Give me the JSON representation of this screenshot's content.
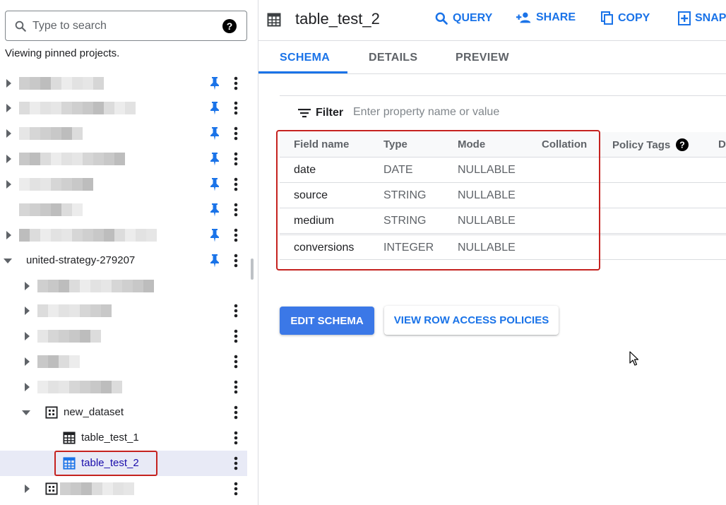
{
  "explorer": {
    "search_placeholder": "Type to search",
    "pinned_message": "Viewing pinned projects.",
    "project_name": "united-strategy-279207",
    "dataset_name": "new_dataset",
    "tables": [
      "table_test_1",
      "table_test_2"
    ],
    "selected_table": "table_test_2"
  },
  "table_header": {
    "title": "table_test_2",
    "actions": [
      "QUERY",
      "SHARE",
      "COPY",
      "SNAP"
    ]
  },
  "tabs": [
    "SCHEMA",
    "DETAILS",
    "PREVIEW"
  ],
  "active_tab": "SCHEMA",
  "filter": {
    "label": "Filter",
    "placeholder": "Enter property name or value"
  },
  "schema": {
    "columns": [
      "Field name",
      "Type",
      "Mode",
      "Collation",
      "Policy Tags",
      "De"
    ],
    "rows": [
      {
        "name": "date",
        "type": "DATE",
        "mode": "NULLABLE"
      },
      {
        "name": "source",
        "type": "STRING",
        "mode": "NULLABLE"
      },
      {
        "name": "medium",
        "type": "STRING",
        "mode": "NULLABLE"
      },
      {
        "name": "conversions",
        "type": "INTEGER",
        "mode": "NULLABLE"
      }
    ]
  },
  "buttons": {
    "edit_schema": "EDIT SCHEMA",
    "view_row_access": "VIEW ROW ACCESS POLICIES"
  },
  "colors": {
    "accent": "#1a73e8",
    "primary_button": "#3b78e7",
    "highlight_box": "#c5221f",
    "selected_row": "#e8eaf6"
  },
  "icons": {
    "search": "search-icon",
    "help": "help-icon",
    "pin": "pin-icon",
    "more": "more-vert-icon",
    "table": "table-icon",
    "dataset": "dataset-icon",
    "query": "search-icon",
    "share": "person-add-icon",
    "copy": "copy-icon",
    "snapshot": "snapshot-icon",
    "filter": "filter-icon"
  }
}
